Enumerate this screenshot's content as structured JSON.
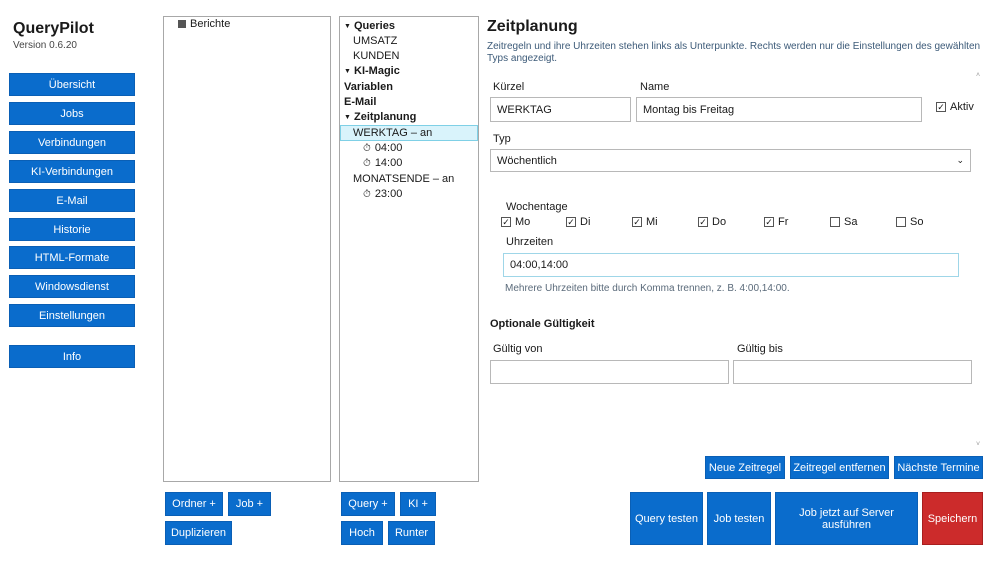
{
  "app": {
    "title": "QueryPilot",
    "version": "Version 0.6.20"
  },
  "nav": [
    {
      "label": "Übersicht"
    },
    {
      "label": "Jobs"
    },
    {
      "label": "Verbindungen"
    },
    {
      "label": "KI-Verbindungen"
    },
    {
      "label": "E-Mail"
    },
    {
      "label": "Historie"
    },
    {
      "label": "HTML-Formate"
    },
    {
      "label": "Windowsdienst"
    },
    {
      "label": "Einstellungen"
    }
  ],
  "nav_info": "Info",
  "folder_tree": {
    "root": "Berichte"
  },
  "folder_buttons": {
    "ordner": "Ordner +",
    "job": "Job +",
    "duplizieren": "Duplizieren"
  },
  "job_tree": {
    "queries": "Queries",
    "umsatz": "UMSATZ",
    "kunden": "KUNDEN",
    "kimagic": "KI-Magic",
    "variablen": "Variablen",
    "email": "E-Mail",
    "zeitplanung": "Zeitplanung",
    "werktag": "WERKTAG – an",
    "werktag_t1": "04:00",
    "werktag_t2": "14:00",
    "monatsende": "MONATSENDE – an",
    "monatsende_t1": "23:00"
  },
  "job_buttons": {
    "query": "Query +",
    "ki": "KI +",
    "hoch": "Hoch",
    "runter": "Runter"
  },
  "detail": {
    "title": "Zeitplanung",
    "description": "Zeitregeln und ihre Uhrzeiten stehen links als Unterpunkte. Rechts werden nur die Einstellungen des gewählten Typs angezeigt.",
    "kuerzel_label": "Kürzel",
    "kuerzel_value": "WERKTAG",
    "name_label": "Name",
    "name_value": "Montag bis Freitag",
    "aktiv_label": "Aktiv",
    "typ_label": "Typ",
    "typ_value": "Wöchentlich",
    "wochentage_label": "Wochentage",
    "days": [
      {
        "label": "Mo",
        "checked": true
      },
      {
        "label": "Di",
        "checked": true
      },
      {
        "label": "Mi",
        "checked": true
      },
      {
        "label": "Do",
        "checked": true
      },
      {
        "label": "Fr",
        "checked": true
      },
      {
        "label": "Sa",
        "checked": false
      },
      {
        "label": "So",
        "checked": false
      }
    ],
    "uhrzeiten_label": "Uhrzeiten",
    "uhrzeiten_value": "04:00,14:00",
    "uhrzeiten_hint": "Mehrere Uhrzeiten bitte durch Komma trennen, z. B. 4:00,14:00.",
    "gueltigkeit_title": "Optionale Gültigkeit",
    "gueltig_von_label": "Gültig von",
    "gueltig_bis_label": "Gültig bis"
  },
  "rule_buttons": {
    "neu": "Neue Zeitregel",
    "entfernen": "Zeitregel entfernen",
    "termine": "Nächste Termine"
  },
  "action_buttons": {
    "query_testen": "Query testen",
    "job_testen": "Job testen",
    "server": "Job jetzt auf Server ausführen",
    "speichern": "Speichern"
  },
  "colors": {
    "accent": "#0a6ccc",
    "danger": "#cc2b2b",
    "selection": "#d9f3fb"
  }
}
